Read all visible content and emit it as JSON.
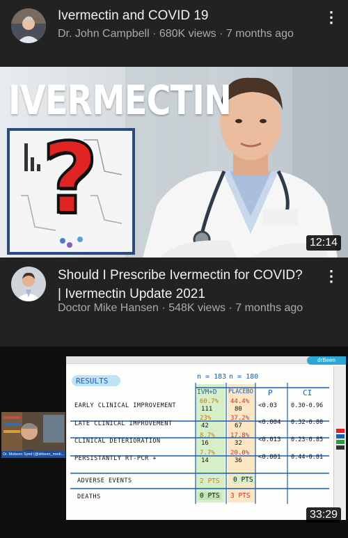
{
  "videos": [
    {
      "title": "Ivermectin and COVID 19",
      "channel": "Dr. John Campbell",
      "views": "680K views",
      "age": "7 months ago",
      "separator": "·"
    },
    {
      "title_line1": "Should I Prescribe Ivermectin for COVID?",
      "title_line2": "| Ivermectin Update 2021",
      "channel": "Doctor Mike Hansen",
      "views": "548K views",
      "age": "7 months ago",
      "separator": "·",
      "thumb_text": "IVERMECTIN",
      "question_mark": "?",
      "duration": "12:14"
    },
    {
      "duration": "33:29",
      "webcam_caption": "Dr. Mobeen Syed (@drbeen_medi...",
      "board": {
        "results": "RESULTS",
        "n1": "n = 183",
        "n2": "n = 180",
        "h_ivm": "IVM+D",
        "h_placebo": "PLACEBO",
        "h_p": "P",
        "h_ci": "CI",
        "rows": [
          {
            "label": "EARLY CLINICAL IMPROVEMENT",
            "ivm_pct": "60.7%",
            "ivm_n": "111",
            "pl_pct": "44.4%",
            "pl_n": "80",
            "p": "<0.03",
            "ci": "0.30-0.96"
          },
          {
            "label": "LATE CLINICAL IMPROVEMENT",
            "ivm_pct": "23%",
            "ivm_n": "42",
            "pl_pct": "37.2%",
            "pl_n": "67",
            "p": "<0.004",
            "ci": "0.32-0.80"
          },
          {
            "label": "CLINICAL DETERIORATION",
            "ivm_pct": "8.7%",
            "ivm_n": "16",
            "pl_pct": "17.8%",
            "pl_n": "32",
            "p": "<0.013",
            "ci": "0.23-0.85"
          },
          {
            "label": "PERSISTANTLY RT-PCR +",
            "ivm_pct": "7.7%",
            "ivm_n": "14",
            "pl_pct": "20.0%",
            "pl_n": "36",
            "p": "<0.001",
            "ci": "0.44-0.81"
          },
          {
            "label": "ADVERSE EVENTS",
            "ivm_pct": "",
            "ivm_n": "2 PTS",
            "pl_pct": "",
            "pl_n": "0 PTS",
            "p": "",
            "ci": ""
          },
          {
            "label": "DEATHS",
            "ivm_pct": "",
            "ivm_n": "0 PTS",
            "pl_pct": "",
            "pl_n": "3 PTS",
            "p": "",
            "ci": ""
          }
        ]
      }
    }
  ],
  "colors": {
    "background": "#222222",
    "title": "#f1f1f1",
    "meta": "#aaaaaa",
    "accent_red": "#e02424",
    "board_blue": "#1a5fb4"
  },
  "icons": [
    "more-vert-icon"
  ]
}
